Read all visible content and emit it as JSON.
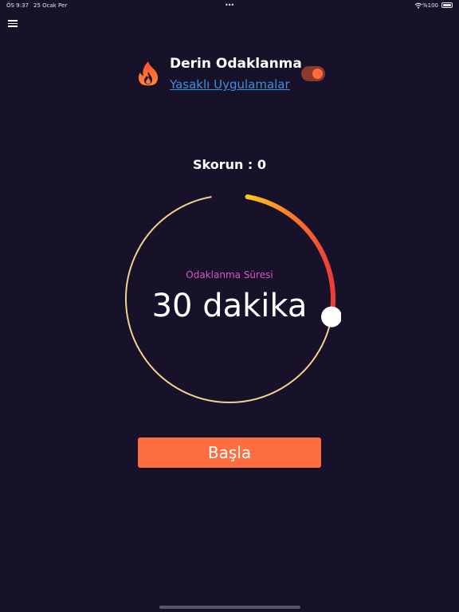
{
  "status_bar": {
    "time": "ÖS 9:37",
    "date": "25 Ocak Per",
    "dots": "•••",
    "wifi_icon": "wifi-icon",
    "battery_label": "%100",
    "battery_level": 1.0
  },
  "menu": {
    "icon": "hamburger-menu-icon"
  },
  "header": {
    "icon": "flame-icon",
    "title": "Derin Odaklanma",
    "link": "Yasaklı Uygulamalar",
    "toggle_on": true
  },
  "score": {
    "text": "Skorun : 0"
  },
  "timer": {
    "caption": "Odaklanma Süresi",
    "value": "30 dakika",
    "minutes": 30,
    "max_minutes": 120
  },
  "start_button": {
    "label": "Başla"
  },
  "colors": {
    "background": "#17122a",
    "accent": "#ff6e40",
    "link": "#3d8fe0",
    "caption": "#d657c4",
    "ring": "#f3d28b",
    "arc_start": "#ffc61a",
    "arc_end": "#ef3b3b"
  }
}
